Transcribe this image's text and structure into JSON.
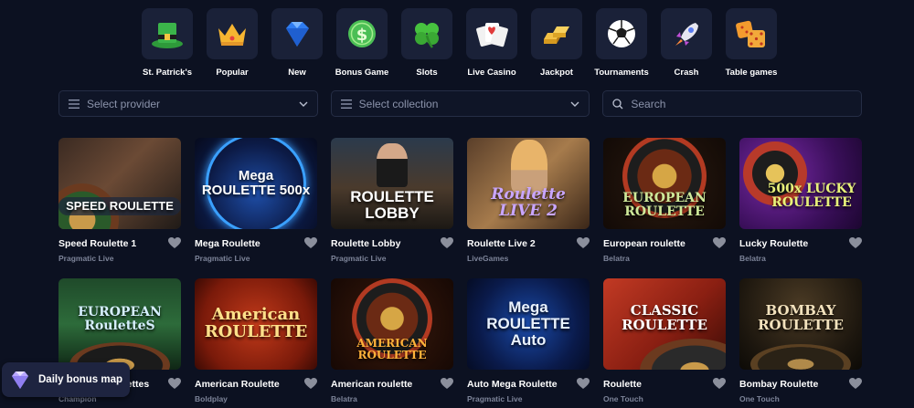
{
  "categories": [
    {
      "label": "St. Patrick's",
      "icon": "leprechaun-hat-icon"
    },
    {
      "label": "Popular",
      "icon": "crown-icon"
    },
    {
      "label": "New",
      "icon": "diamond-icon"
    },
    {
      "label": "Bonus Game",
      "icon": "dollar-coin-icon"
    },
    {
      "label": "Slots",
      "icon": "clover-icon"
    },
    {
      "label": "Live Casino",
      "icon": "playing-cards-icon"
    },
    {
      "label": "Jackpot",
      "icon": "gold-bars-icon"
    },
    {
      "label": "Tournaments",
      "icon": "soccer-ball-icon"
    },
    {
      "label": "Crash",
      "icon": "rocket-icon"
    },
    {
      "label": "Table games",
      "icon": "dice-icon"
    }
  ],
  "filters": {
    "provider_placeholder": "Select provider",
    "collection_placeholder": "Select collection",
    "search_placeholder": "Search"
  },
  "games": [
    {
      "name": "Speed Roulette 1",
      "provider": "Pragmatic Live",
      "thumb_text": "SPEED ROULETTE"
    },
    {
      "name": "Mega Roulette",
      "provider": "Pragmatic Live",
      "thumb_text": "Mega ROULETTE 500x"
    },
    {
      "name": "Roulette Lobby",
      "provider": "Pragmatic Live",
      "thumb_text": "ROULETTE LOBBY"
    },
    {
      "name": "Roulette Live 2",
      "provider": "LiveGames",
      "thumb_text": "Roulette LIVE 2"
    },
    {
      "name": "European roulette",
      "provider": "Belatra",
      "thumb_text": "EUROPEAN ROULETTE"
    },
    {
      "name": "Lucky Roulette",
      "provider": "Belatra",
      "thumb_text": "500x LUCKY ROULETTE"
    },
    {
      "name": "European Roulettes",
      "provider": "Champion",
      "thumb_text": "EUROPEAN RouletteS"
    },
    {
      "name": "American Roulette",
      "provider": "Boldplay",
      "thumb_text": "American ROULETTE"
    },
    {
      "name": "American roulette",
      "provider": "Belatra",
      "thumb_text": "AMERICAN ROULETTE"
    },
    {
      "name": "Auto Mega Roulette",
      "provider": "Pragmatic Live",
      "thumb_text": "Mega ROULETTE Auto"
    },
    {
      "name": "Roulette",
      "provider": "One Touch",
      "thumb_text": "CLASSIC ROULETTE"
    },
    {
      "name": "Bombay Roulette",
      "provider": "One Touch",
      "thumb_text": "BOMBAY ROULETTE"
    }
  ],
  "bonus_map": {
    "label": "Daily bonus map",
    "icon": "diamond-icon"
  },
  "colors": {
    "background": "#0c1121",
    "tile": "#1a2138",
    "provider_text": "#7d8499",
    "heart": "#8b8f9c"
  }
}
